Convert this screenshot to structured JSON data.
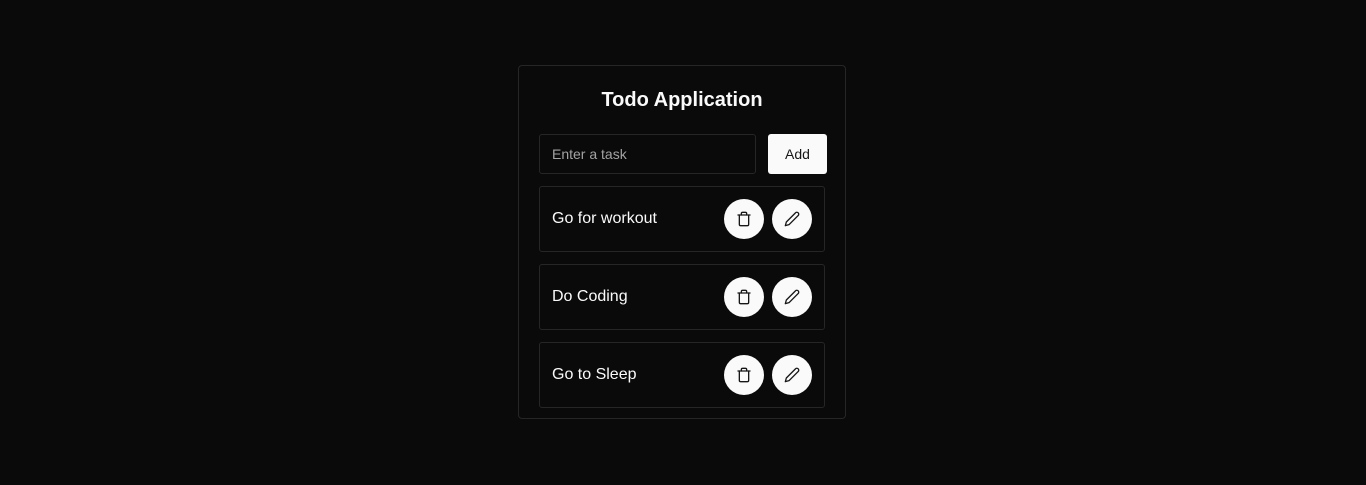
{
  "app": {
    "title": "Todo Application"
  },
  "form": {
    "placeholder": "Enter a task",
    "value": "",
    "add_label": "Add"
  },
  "tasks": [
    {
      "text": "Go for workout"
    },
    {
      "text": "Do Coding"
    },
    {
      "text": "Go to Sleep"
    }
  ],
  "icons": {
    "delete": "trash-icon",
    "edit": "pencil-icon"
  },
  "colors": {
    "background": "#0a0a0a",
    "border": "#262626",
    "button": "#fafafa",
    "text": "#fafafa"
  }
}
